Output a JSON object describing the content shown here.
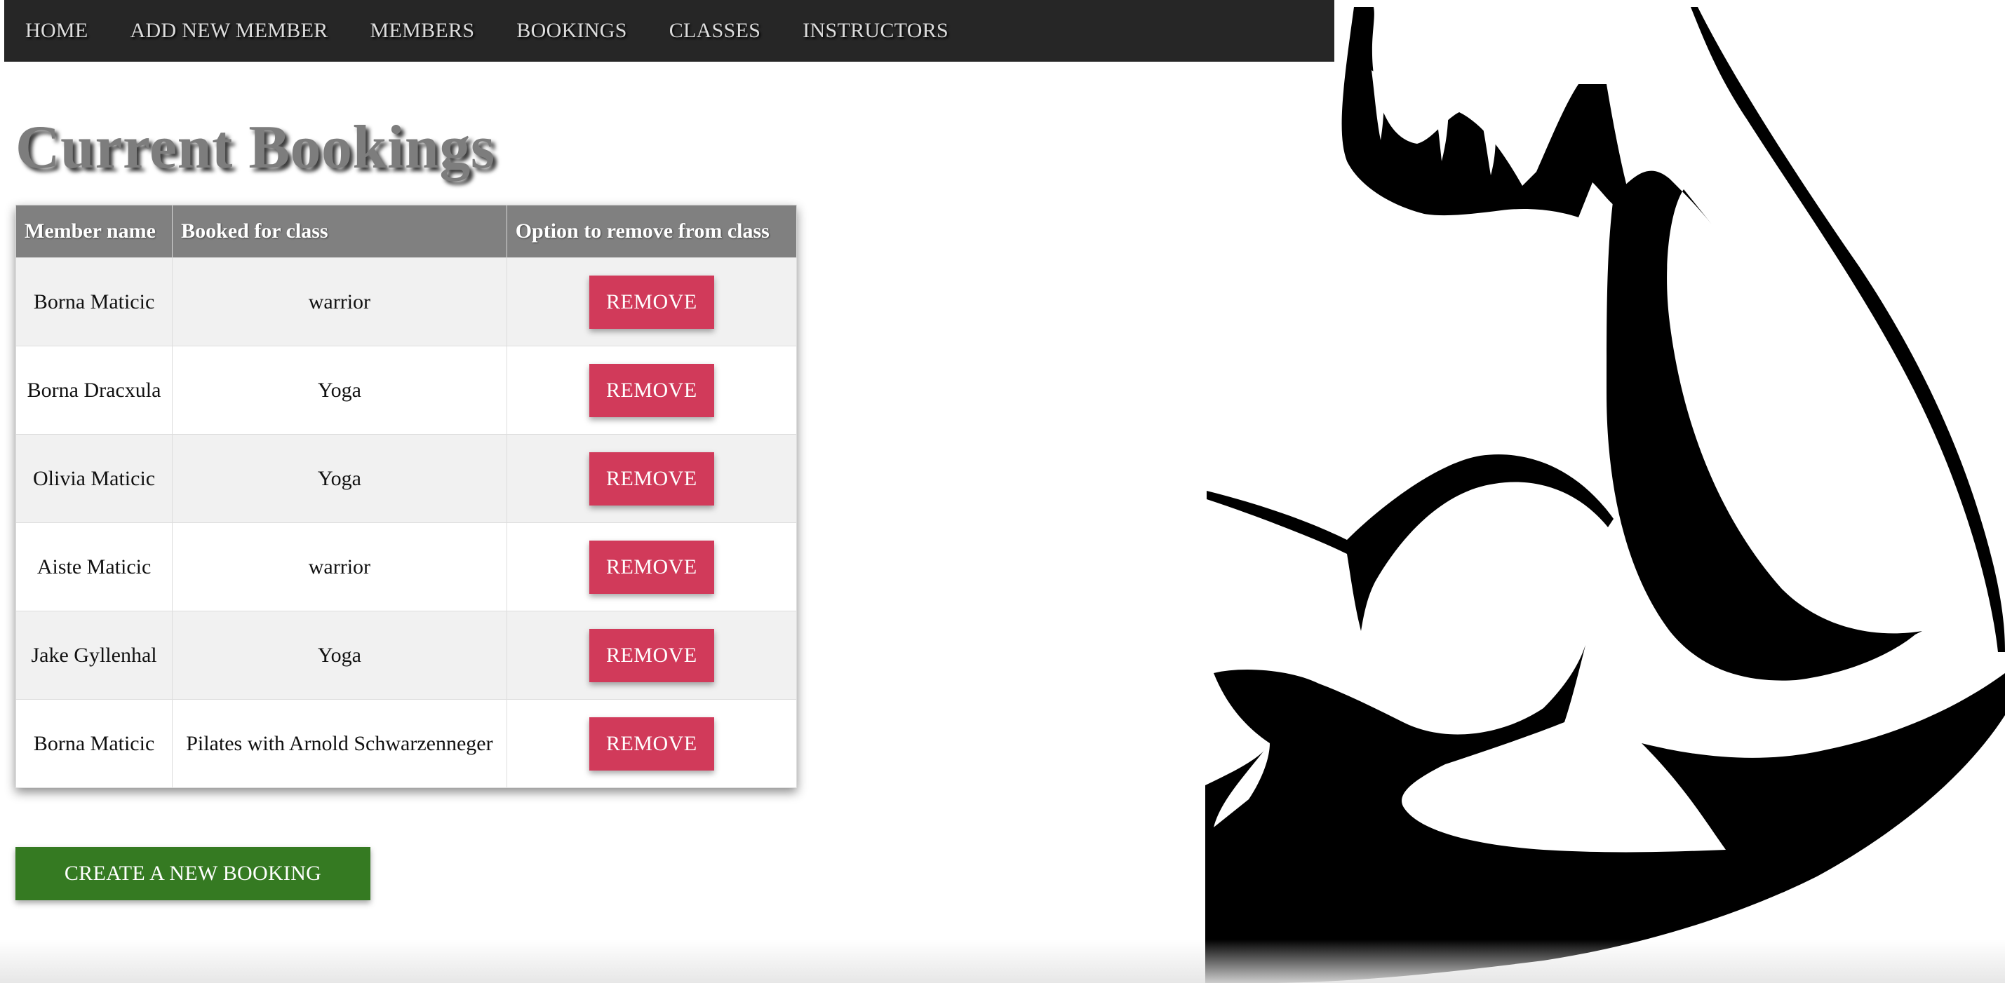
{
  "nav": {
    "items": [
      {
        "label": "HOME"
      },
      {
        "label": "ADD NEW MEMBER"
      },
      {
        "label": "MEMBERS"
      },
      {
        "label": "BOOKINGS"
      },
      {
        "label": "CLASSES"
      },
      {
        "label": "INSTRUCTORS"
      }
    ]
  },
  "page": {
    "title": "Current Bookings"
  },
  "table": {
    "headers": [
      "Member name",
      "Booked for class",
      "Option to remove from class"
    ],
    "rows": [
      {
        "member": "Borna Maticic",
        "class": "warrior",
        "action": "REMOVE"
      },
      {
        "member": "Borna Dracxula",
        "class": "Yoga",
        "action": "REMOVE"
      },
      {
        "member": "Olivia Maticic",
        "class": "Yoga",
        "action": "REMOVE"
      },
      {
        "member": "Aiste Maticic",
        "class": "warrior",
        "action": "REMOVE"
      },
      {
        "member": "Jake Gyllenhal",
        "class": "Yoga",
        "action": "REMOVE"
      },
      {
        "member": "Borna Maticic",
        "class": "Pilates with Arnold Schwarzenneger",
        "action": "REMOVE"
      }
    ]
  },
  "actions": {
    "create_label": "CREATE A NEW BOOKING"
  },
  "decor": {
    "illustration": "flexed-bicep-illustration"
  },
  "colors": {
    "nav_bg": "#262626",
    "header_bg": "#808080",
    "remove_button": "#d13a5a",
    "create_button": "#357a22"
  }
}
